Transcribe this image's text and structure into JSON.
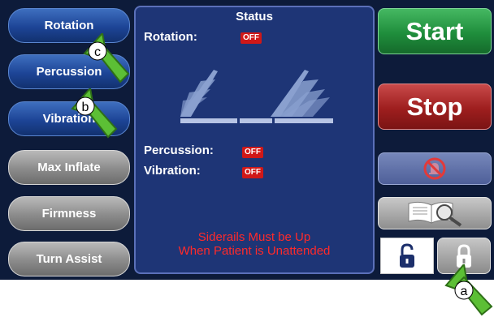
{
  "left_buttons": [
    {
      "label": "Rotation"
    },
    {
      "label": "Percussion"
    },
    {
      "label": "Vibration"
    },
    {
      "label": "Max Inflate"
    },
    {
      "label": "Firmness"
    },
    {
      "label": "Turn Assist"
    }
  ],
  "status": {
    "title": "Status",
    "rotation_label": "Rotation:",
    "rotation_value": "OFF",
    "percussion_label": "Percussion:",
    "percussion_value": "OFF",
    "vibration_label": "Vibration:",
    "vibration_value": "OFF",
    "warning_line1": "Siderails Must be Up",
    "warning_line2": "When Patient is Unattended"
  },
  "right_buttons": {
    "start_label": "Start",
    "stop_label": "Stop",
    "alarm_icon": "alarm-silenced-icon",
    "manual_icon": "manual-magnifier-icon",
    "unlock_icon": "unlocked-padlock-icon",
    "lock_icon": "locked-padlock-icon"
  },
  "markers": {
    "a": "a",
    "b": "b",
    "c": "c"
  },
  "colors": {
    "screen_bg": "#0d1b3a",
    "status_panel": "#1e3576",
    "off_badge": "#d01818",
    "warning_text": "#ff2a2a",
    "start_green": "#1f8e3c",
    "stop_red": "#9e1e1e",
    "arrow_green": "#5cbf35"
  }
}
